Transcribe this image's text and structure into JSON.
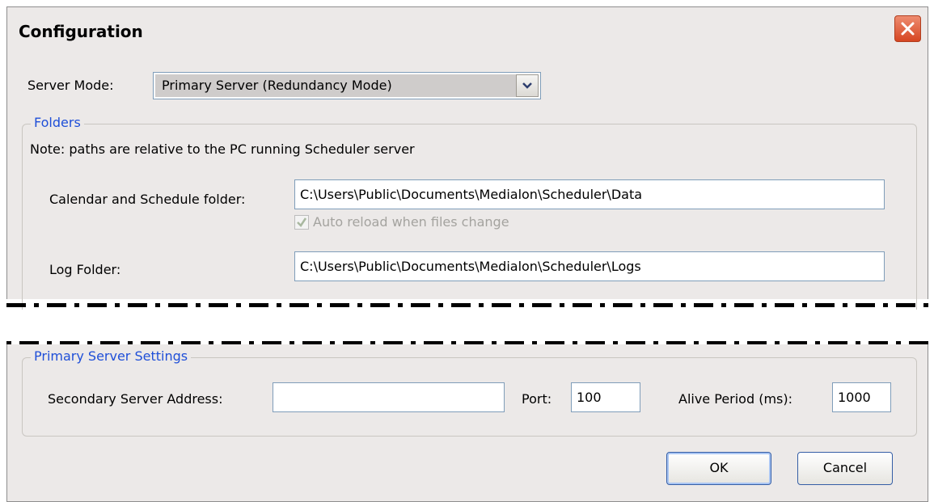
{
  "window": {
    "title": "Configuration"
  },
  "server_mode": {
    "label": "Server Mode:",
    "selected": "Primary Server (Redundancy Mode)"
  },
  "folders": {
    "group_title": "Folders",
    "note": "Note: paths are relative to the PC running Scheduler server",
    "calendar_label": "Calendar and Schedule folder:",
    "calendar_value": "C:\\Users\\Public\\Documents\\Medialon\\Scheduler\\Data",
    "auto_reload_label": "Auto reload when files change",
    "auto_reload_checked": true,
    "log_label": "Log Folder:",
    "log_value": "C:\\Users\\Public\\Documents\\Medialon\\Scheduler\\Logs"
  },
  "primary_settings": {
    "group_title": "Primary Server Settings",
    "secondary_label": "Secondary Server Address:",
    "secondary_value": "",
    "port_label": "Port:",
    "port_value": "100",
    "alive_label": "Alive Period (ms):",
    "alive_value": "1000"
  },
  "buttons": {
    "ok": "OK",
    "cancel": "Cancel"
  },
  "colors": {
    "dialog_bg": "#ece9e8",
    "group_title": "#1f4fd8",
    "close_red": "#d64622"
  }
}
